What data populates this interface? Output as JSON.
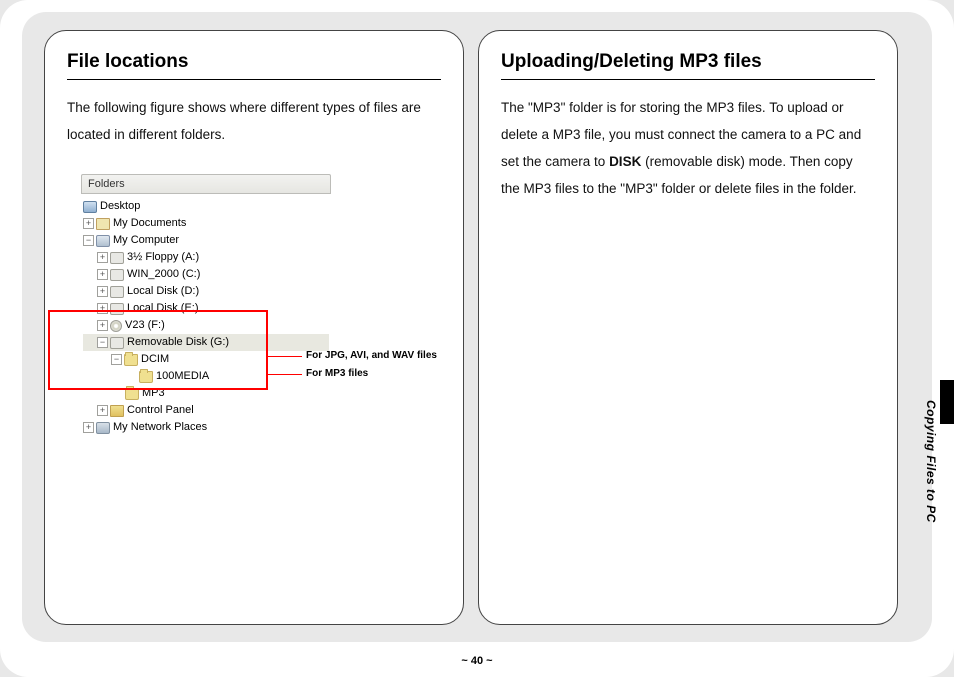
{
  "left": {
    "title": "File locations",
    "intro": "The following figure shows where different types of files are located in different folders.",
    "folders_label": "Folders",
    "tree": {
      "desktop": "Desktop",
      "mydocs": "My Documents",
      "mycomputer": "My Computer",
      "floppy": "3½ Floppy (A:)",
      "win2000": "WIN_2000 (C:)",
      "localD": "Local Disk (D:)",
      "localE": "Local Disk (E:)",
      "v23": "V23 (F:)",
      "removable": "Removable Disk (G:)",
      "dcim": "DCIM",
      "media": "100MEDIA",
      "mp3": "MP3",
      "control": "Control Panel",
      "network": "My Network Places"
    },
    "callout_media": "For JPG, AVI, and WAV files",
    "callout_mp3": "For MP3 files"
  },
  "right": {
    "title": "Uploading/Deleting MP3 files",
    "para_a": "The \"MP3\" folder is for storing the MP3 files. To upload or delete a MP3 file, you must connect the camera to a PC and set the camera to ",
    "para_bold": "DISK",
    "para_b": " (removable disk) mode. Then copy the MP3 files to the \"MP3\" folder or delete files in the folder."
  },
  "page_number": "~ 40 ~",
  "side_label": "Copying Files to PC"
}
